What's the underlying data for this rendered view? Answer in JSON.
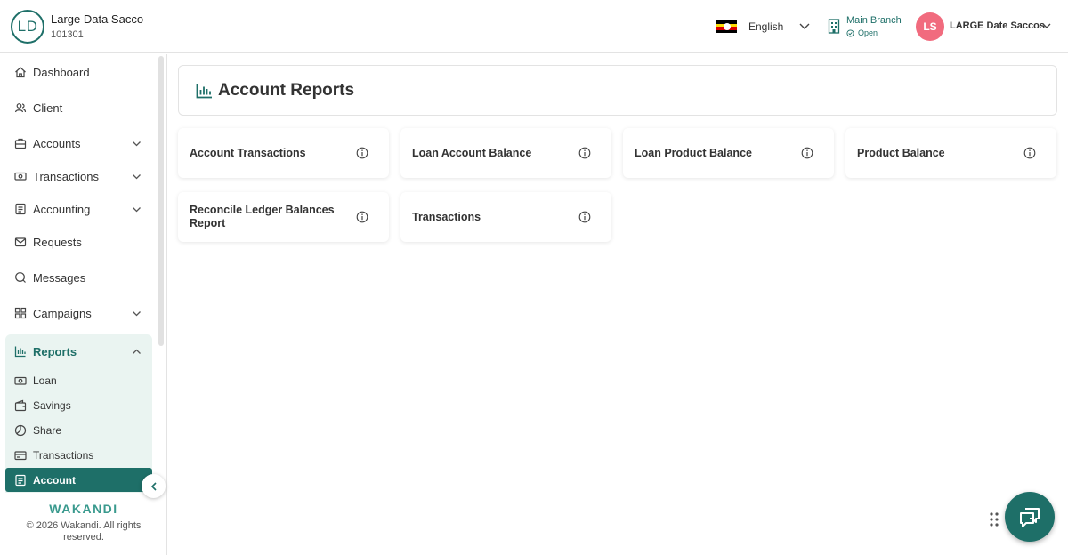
{
  "header": {
    "org_initials": "LD",
    "org_name": "Large Data Sacco",
    "org_code": "101301",
    "language": "English",
    "branch_name": "Main Branch",
    "branch_status": "Open",
    "user_initials": "LS",
    "user_name": "LARGE Date Saccos"
  },
  "sidebar": {
    "items": [
      {
        "label": "Dashboard",
        "icon": "home-icon"
      },
      {
        "label": "Client",
        "icon": "users-icon"
      },
      {
        "label": "Accounts",
        "icon": "briefcase-icon"
      },
      {
        "label": "Transactions",
        "icon": "banknote-icon"
      },
      {
        "label": "Accounting",
        "icon": "ledger-icon"
      },
      {
        "label": "Requests",
        "icon": "mail-icon"
      },
      {
        "label": "Messages",
        "icon": "chat-icon"
      },
      {
        "label": "Campaigns",
        "icon": "grid-icon"
      }
    ],
    "reports": {
      "label": "Reports",
      "sub_items": [
        {
          "label": "Loan"
        },
        {
          "label": "Savings"
        },
        {
          "label": "Share"
        },
        {
          "label": "Transactions"
        },
        {
          "label": "Account"
        }
      ]
    },
    "brand": "WAKANDI",
    "copyright": "© 2026 Wakandi. All rights reserved."
  },
  "main": {
    "title": "Account Reports",
    "cards": [
      {
        "label": "Account Transactions"
      },
      {
        "label": "Loan Account Balance"
      },
      {
        "label": "Loan Product Balance"
      },
      {
        "label": "Product Balance"
      },
      {
        "label": "Reconcile Ledger Balances Report"
      },
      {
        "label": "Transactions"
      }
    ]
  },
  "colors": {
    "accent": "#1e6f68",
    "active_group_bg": "#eaf4f1",
    "user_avatar": "#f16b7e"
  }
}
